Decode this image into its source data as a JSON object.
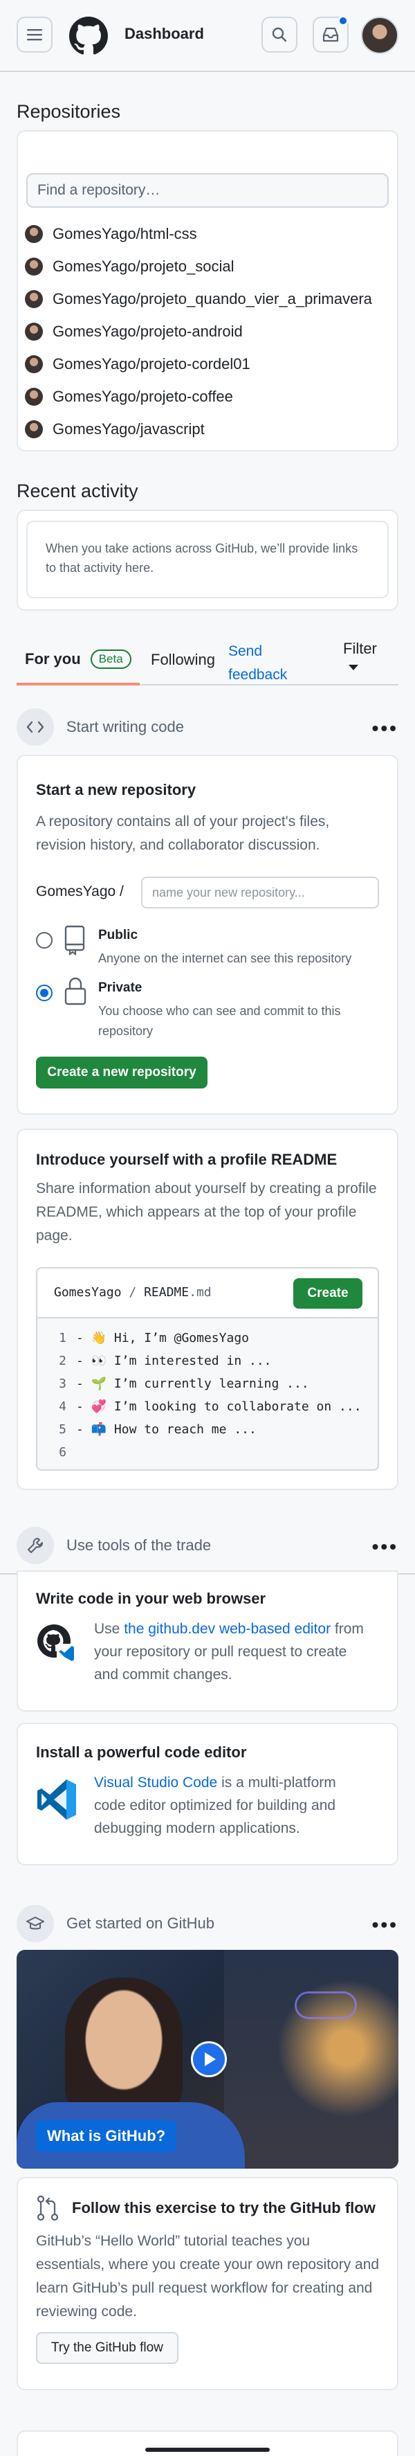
{
  "header": {
    "title": "Dashboard"
  },
  "repositories": {
    "title": "Repositories",
    "search_placeholder": "Find a repository…",
    "items": [
      {
        "name": "GomesYago/html-css"
      },
      {
        "name": "GomesYago/projeto_social"
      },
      {
        "name": "GomesYago/projeto_quando_vier_a_primavera"
      },
      {
        "name": "GomesYago/projeto-android"
      },
      {
        "name": "GomesYago/projeto-cordel01"
      },
      {
        "name": "GomesYago/projeto-coffee"
      },
      {
        "name": "GomesYago/javascript"
      }
    ]
  },
  "recent_activity": {
    "title": "Recent activity",
    "empty_text": "When you take actions across GitHub, we’ll provide links to that activity here."
  },
  "tabs": {
    "for_you": "For you",
    "beta": "Beta",
    "following": "Following",
    "send_feedback": "Send feedback",
    "filter": "Filter"
  },
  "start_writing": {
    "heading": "Start writing code",
    "new_repo": {
      "title": "Start a new repository",
      "description": "A repository contains all of your project's files, revision history, and collaborator discussion.",
      "owner": "GomesYago /",
      "name_placeholder": "name your new repository...",
      "public_label": "Public",
      "public_desc": "Anyone on the internet can see this repository",
      "private_label": "Private",
      "private_desc": "You choose who can see and commit to this repository",
      "create_button": "Create a new repository",
      "selected_visibility": "Private"
    },
    "readme": {
      "title": "Introduce yourself with a profile README",
      "description": "Share information about yourself by creating a profile README, which appears at the top of your profile page.",
      "path_user": "GomesYago",
      "path_sep": "/",
      "path_file": "README",
      "path_ext": ".md",
      "create_button": "Create",
      "lines": [
        {
          "num": "1",
          "text": "- 👋 Hi, I’m @GomesYago"
        },
        {
          "num": "2",
          "text": "- 👀 I’m interested in ..."
        },
        {
          "num": "3",
          "text": "- 🌱 I’m currently learning ..."
        },
        {
          "num": "4",
          "text": "- 💞️ I’m looking to collaborate on ..."
        },
        {
          "num": "5",
          "text": "- 📫 How to reach me ..."
        },
        {
          "num": "6",
          "text": ""
        }
      ]
    }
  },
  "tools": {
    "heading": "Use tools of the trade",
    "browser": {
      "title": "Write code in your web browser",
      "pre": "Use ",
      "link": "the github.dev web-based editor",
      "post": " from your repository or pull request to create and commit changes."
    },
    "editor": {
      "title": "Install a powerful code editor",
      "link": "Visual Studio Code",
      "post": " is a multi-platform code editor optimized for building and debugging modern applications."
    }
  },
  "get_started": {
    "heading": "Get started on GitHub",
    "video_label": "What is GitHub?",
    "flow_title": "Follow this exercise to try the GitHub flow",
    "flow_desc": "GitHub’s “Hello World” tutorial teaches you essentials, where you create your own repository and learn GitHub’s pull request workflow for creating and reviewing code.",
    "flow_button": "Try the GitHub flow"
  },
  "colors": {
    "accent": "#0969da",
    "green": "#1f883d",
    "notification_dot": "#0969da"
  }
}
